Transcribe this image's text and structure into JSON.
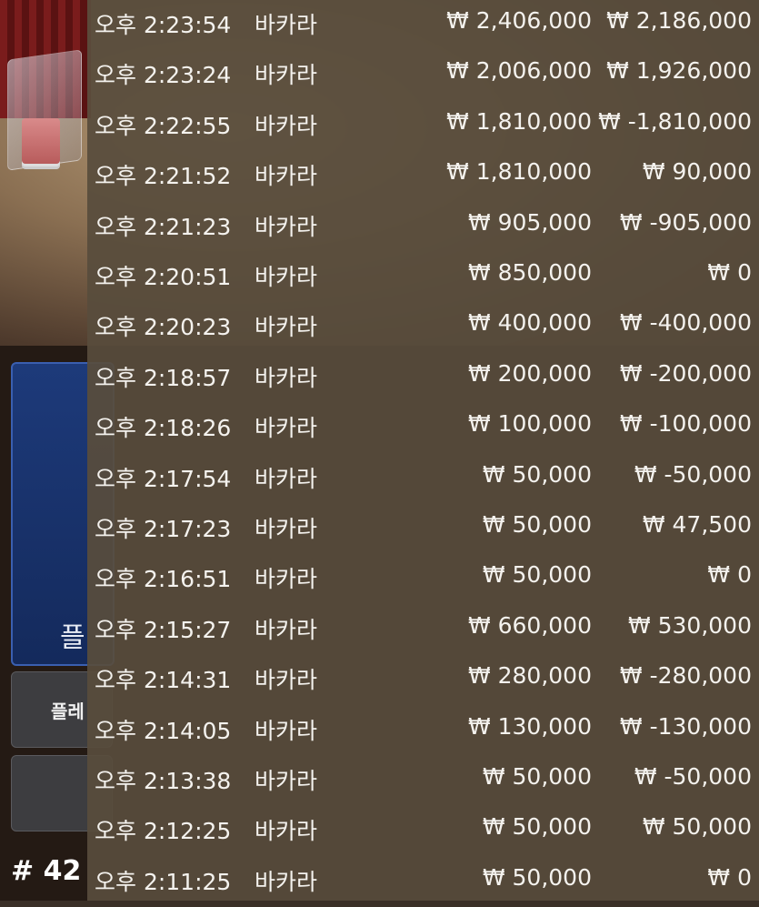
{
  "background": {
    "player_label": "플",
    "button_label": "플레",
    "round_id": "# 42"
  },
  "history": {
    "rows": [
      {
        "time": "오후 2:23:54",
        "game": "바카라",
        "bet": "₩ 2,406,000",
        "win": "₩ 2,186,000"
      },
      {
        "time": "오후 2:23:24",
        "game": "바카라",
        "bet": "₩ 2,006,000",
        "win": "₩ 1,926,000"
      },
      {
        "time": "오후 2:22:55",
        "game": "바카라",
        "bet": "₩ 1,810,000",
        "win": "₩ -1,810,000"
      },
      {
        "time": "오후 2:21:52",
        "game": "바카라",
        "bet": "₩ 1,810,000",
        "win": "₩ 90,000"
      },
      {
        "time": "오후 2:21:23",
        "game": "바카라",
        "bet": "₩ 905,000",
        "win": "₩ -905,000"
      },
      {
        "time": "오후 2:20:51",
        "game": "바카라",
        "bet": "₩ 850,000",
        "win": "₩ 0"
      },
      {
        "time": "오후 2:20:23",
        "game": "바카라",
        "bet": "₩ 400,000",
        "win": "₩ -400,000"
      },
      {
        "time": "오후 2:18:57",
        "game": "바카라",
        "bet": "₩ 200,000",
        "win": "₩ -200,000"
      },
      {
        "time": "오후 2:18:26",
        "game": "바카라",
        "bet": "₩ 100,000",
        "win": "₩ -100,000"
      },
      {
        "time": "오후 2:17:54",
        "game": "바카라",
        "bet": "₩ 50,000",
        "win": "₩ -50,000"
      },
      {
        "time": "오후 2:17:23",
        "game": "바카라",
        "bet": "₩ 50,000",
        "win": "₩ 47,500"
      },
      {
        "time": "오후 2:16:51",
        "game": "바카라",
        "bet": "₩ 50,000",
        "win": "₩ 0"
      },
      {
        "time": "오후 2:15:27",
        "game": "바카라",
        "bet": "₩ 660,000",
        "win": "₩ 530,000"
      },
      {
        "time": "오후 2:14:31",
        "game": "바카라",
        "bet": "₩ 280,000",
        "win": "₩ -280,000"
      },
      {
        "time": "오후 2:14:05",
        "game": "바카라",
        "bet": "₩ 130,000",
        "win": "₩ -130,000"
      },
      {
        "time": "오후 2:13:38",
        "game": "바카라",
        "bet": "₩ 50,000",
        "win": "₩ -50,000"
      },
      {
        "time": "오후 2:12:25",
        "game": "바카라",
        "bet": "₩ 50,000",
        "win": "₩ 50,000"
      },
      {
        "time": "오후 2:11:25",
        "game": "바카라",
        "bet": "₩ 50,000",
        "win": "₩ 0"
      }
    ]
  }
}
